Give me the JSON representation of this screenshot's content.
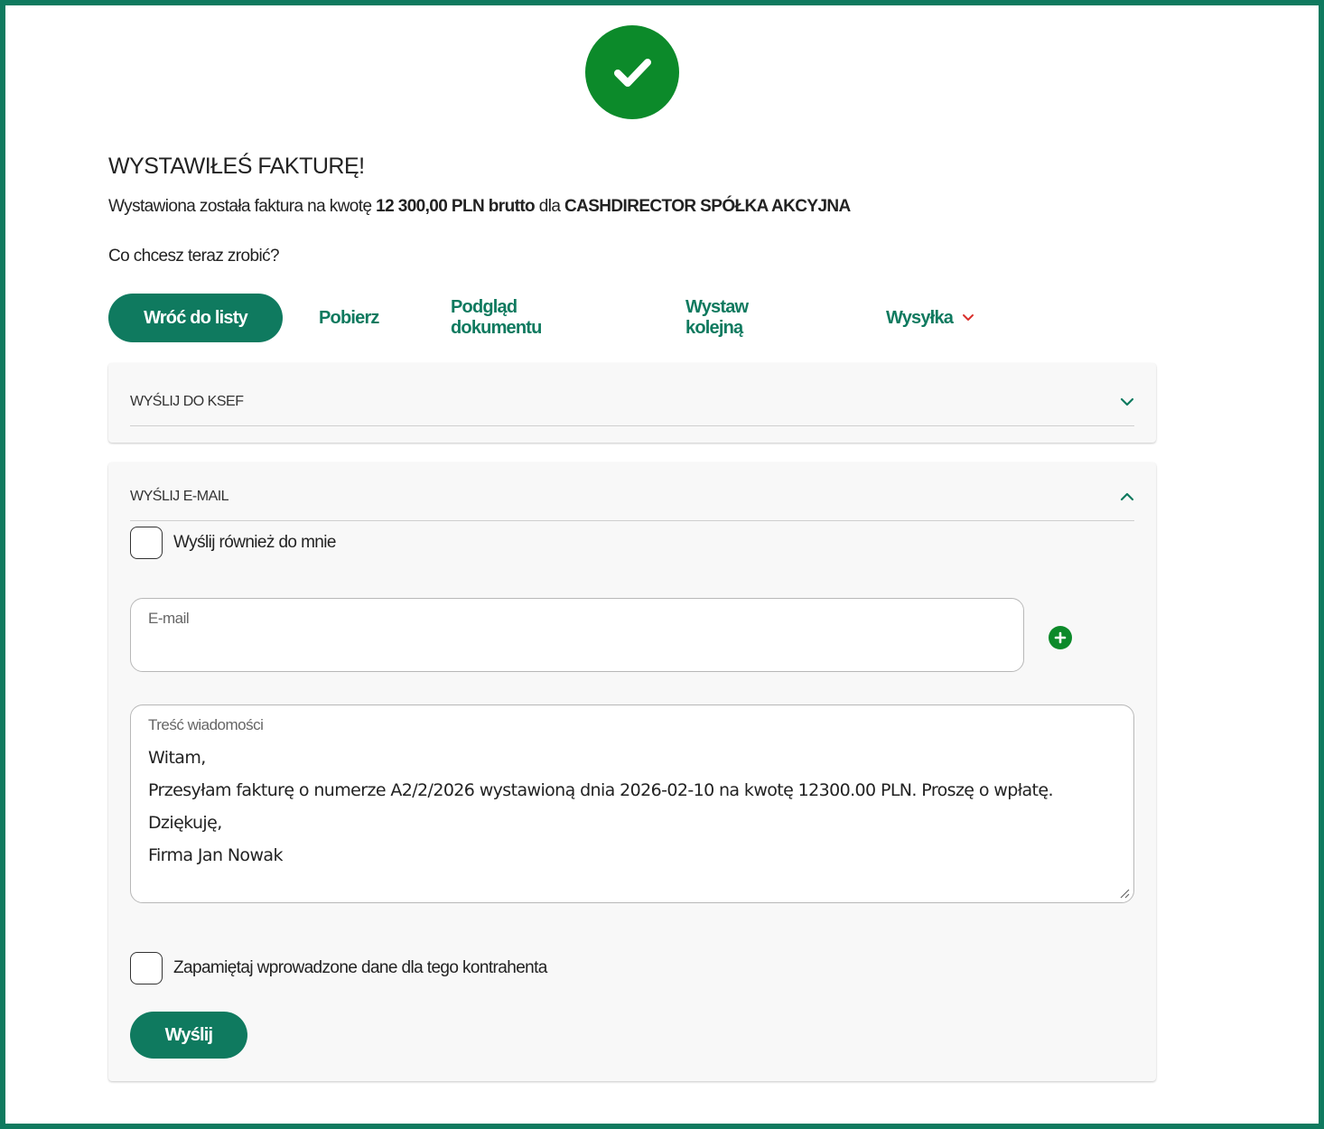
{
  "header": {
    "title": "WYSTAWIŁEŚ FAKTURĘ!",
    "summary": {
      "prefix": "Wystawiona została faktura na kwotę ",
      "amount": "12 300,00 PLN brutto",
      "middle": " dla ",
      "client": "CASHDIRECTOR SPÓŁKA AKCYJNA"
    },
    "question": "Co chcesz teraz zrobić?"
  },
  "actions": {
    "back_label": "Wróć do listy",
    "download_label": "Pobierz",
    "preview_label": "Podgląd dokumentu",
    "issue_next_label": "Wystaw kolejną",
    "shipping_label": "Wysyłka"
  },
  "ksef_panel": {
    "title": "WYŚLIJ DO KSEF"
  },
  "email_panel": {
    "title": "WYŚLIJ E-MAIL",
    "send_copy_label": "Wyślij również do mnie",
    "email_label": "E-mail",
    "email_value": "",
    "message_label": "Treść wiadomości",
    "message_value": "Witam,\nPrzesyłam fakturę o numerze A2/2/2026 wystawioną dnia 2026-02-10 na kwotę 12300.00 PLN. Proszę o wpłatę.\nDziękuję,\nFirma Jan Nowak",
    "remember_label": "Zapamiętaj wprowadzone dane dla tego kontrahenta",
    "send_label": "Wyślij"
  },
  "colors": {
    "accent": "#0f7a5f",
    "success": "#0c8a2a",
    "dropdown_chevron": "#d9302c"
  },
  "icons": {
    "success": "check-circle-icon",
    "add": "plus-circle-icon",
    "expand": "chevron-down-icon",
    "collapse": "chevron-up-icon"
  }
}
